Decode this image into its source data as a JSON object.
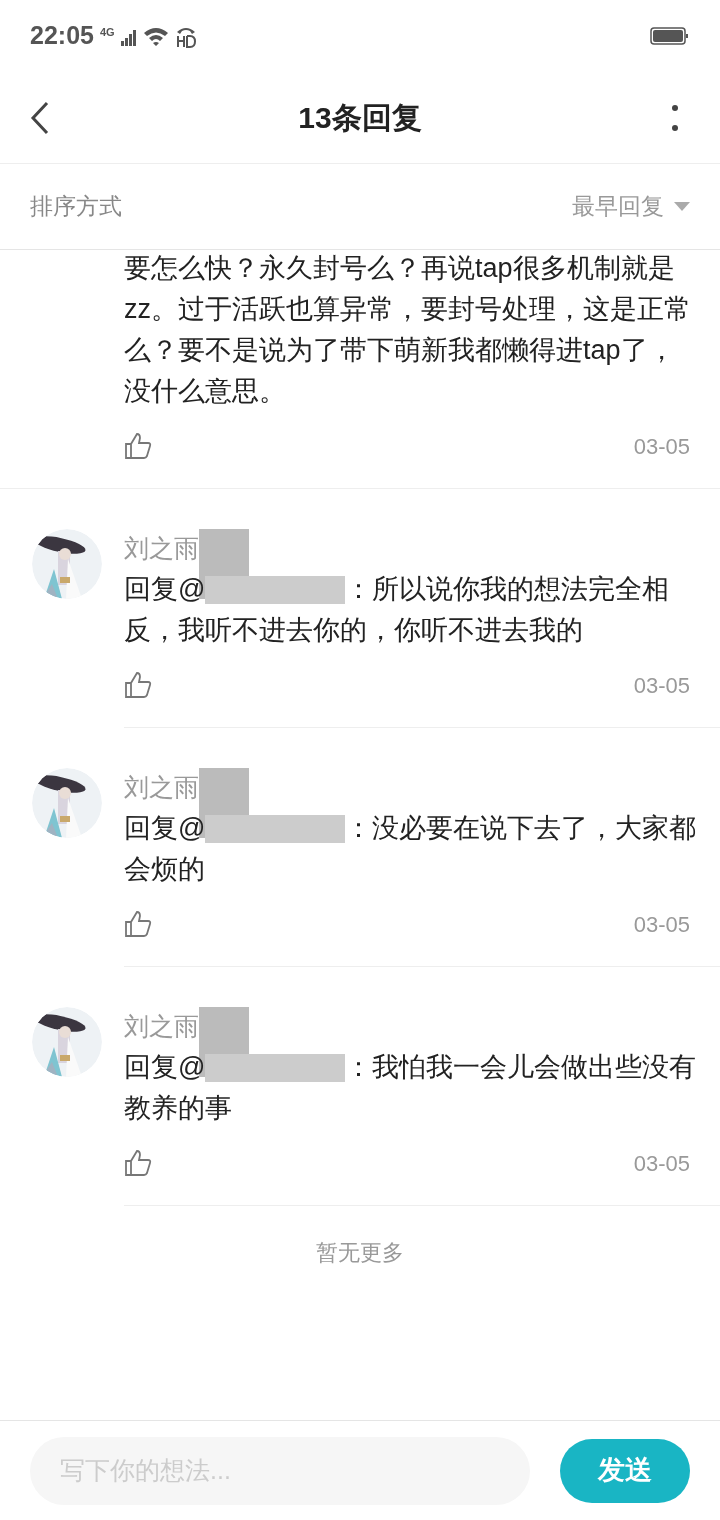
{
  "status_bar": {
    "time": "22:05",
    "network": "4G"
  },
  "header": {
    "title": "13条回复"
  },
  "sort": {
    "label": "排序方式",
    "value": "最早回复"
  },
  "replies": [
    {
      "kind": "partial",
      "text": "要怎么快？永久封号么？再说tap很多机制就是zz。过于活跃也算异常，要封号处理，这是正常么？要不是说为了带下萌新我都懒得进tap了，没什么意思。",
      "date": "03-05"
    },
    {
      "kind": "full",
      "name": "刘之雨",
      "reply_prefix": "回复@",
      "text_lines": [
        "：所以说你我的想法完全相",
        "反，我听不进去你的，你听不进去我的"
      ],
      "date": "03-05"
    },
    {
      "kind": "full",
      "name": "刘之雨",
      "reply_prefix": "回复@",
      "text_lines": [
        "：没必要在说下去了，大家都",
        "会烦的"
      ],
      "date": "03-05"
    },
    {
      "kind": "full",
      "name": "刘之雨",
      "reply_prefix": "回复@",
      "text_lines": [
        "：我怕我一会儿会做出些没有",
        "教养的事"
      ],
      "date": "03-05"
    }
  ],
  "end_note": "暂无更多",
  "composer": {
    "placeholder": "写下你的想法...",
    "send": "发送"
  }
}
